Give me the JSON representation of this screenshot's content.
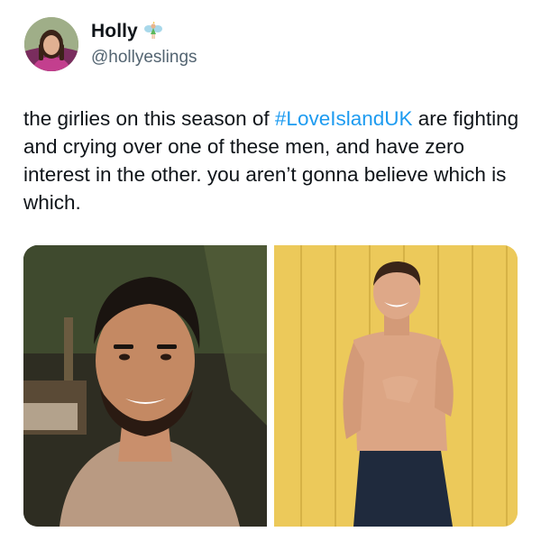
{
  "author": {
    "display_name": "Holly",
    "handle": "@hollyeslings",
    "badge_icon": "fairy-icon"
  },
  "tweet": {
    "text_before": "the girlies on this season of ",
    "hashtag": "#LoveIslandUK",
    "text_after": " are fighting and crying over one of these men, and have zero interest in the other. you aren’t gonna believe which is which."
  },
  "media": {
    "count": 2,
    "images": [
      {
        "name": "man-dark-hair-beard-photo"
      },
      {
        "name": "shirtless-man-yellow-wall-photo"
      }
    ]
  },
  "colors": {
    "text": "#0f1419",
    "secondary": "#536471",
    "link": "#1d9bf0"
  }
}
